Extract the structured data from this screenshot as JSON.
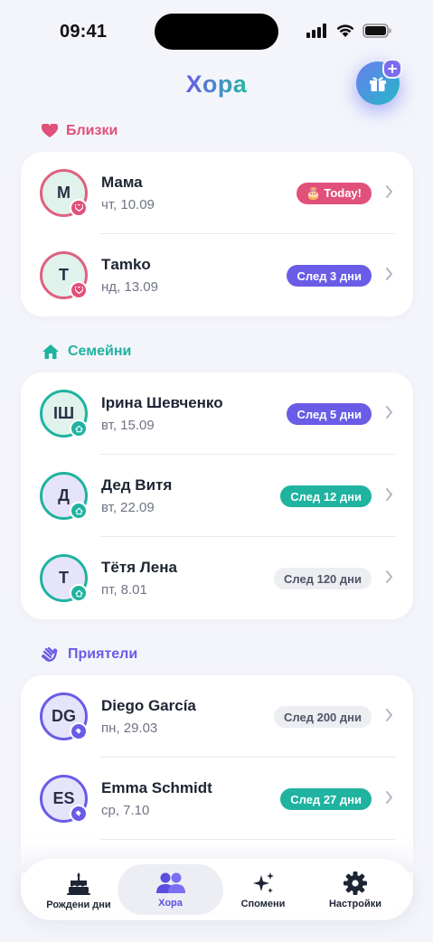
{
  "status_bar": {
    "time": "09:41"
  },
  "header": {
    "title": "Хора"
  },
  "sections": [
    {
      "title": "Близки",
      "color": "#e0507a",
      "icon": "heart-icon",
      "people": [
        {
          "initials": "М",
          "name": "Мама",
          "date": "чт, 10.09",
          "badge": "🎂 Today!",
          "badge_style": "today"
        },
        {
          "initials": "Т",
          "name": "Тamko",
          "date": "нд, 13.09",
          "badge": "След 3 дни",
          "badge_style": "purple"
        }
      ]
    },
    {
      "title": "Семейни",
      "color": "#1fb3a0",
      "icon": "house-icon",
      "people": [
        {
          "initials": "ІШ",
          "name": "Ірина Шевченко",
          "date": "вт, 15.09",
          "badge": "След 5 дни",
          "badge_style": "purple"
        },
        {
          "initials": "Д",
          "name": "Дед Витя",
          "date": "вт, 22.09",
          "badge": "След 12 дни",
          "badge_style": "teal"
        },
        {
          "initials": "Т",
          "name": "Тётя Лена",
          "date": "пт, 8.01",
          "badge": "След 120 дни",
          "badge_style": "gray"
        }
      ]
    },
    {
      "title": "Приятели",
      "color": "#6a5ce6",
      "icon": "wave-hand-icon",
      "people": [
        {
          "initials": "DG",
          "name": "Diego García",
          "date": "пн, 29.03",
          "badge": "След 200 дни",
          "badge_style": "gray"
        },
        {
          "initials": "ES",
          "name": "Emma Schmidt",
          "date": "ср, 7.10",
          "badge": "След 27 дни",
          "badge_style": "teal"
        }
      ]
    }
  ],
  "tab_bar": {
    "tabs": [
      {
        "label": "Рождени дни",
        "icon": "cake-icon"
      },
      {
        "label": "Хора",
        "icon": "people-icon",
        "active": true
      },
      {
        "label": "Спомени",
        "icon": "sparkles-icon"
      },
      {
        "label": "Настройки",
        "icon": "gear-icon"
      }
    ]
  },
  "colors": {
    "purple": "#6a5ce6",
    "teal": "#1fb3a0",
    "pink": "#e0507a",
    "gray": "#eceef2"
  }
}
